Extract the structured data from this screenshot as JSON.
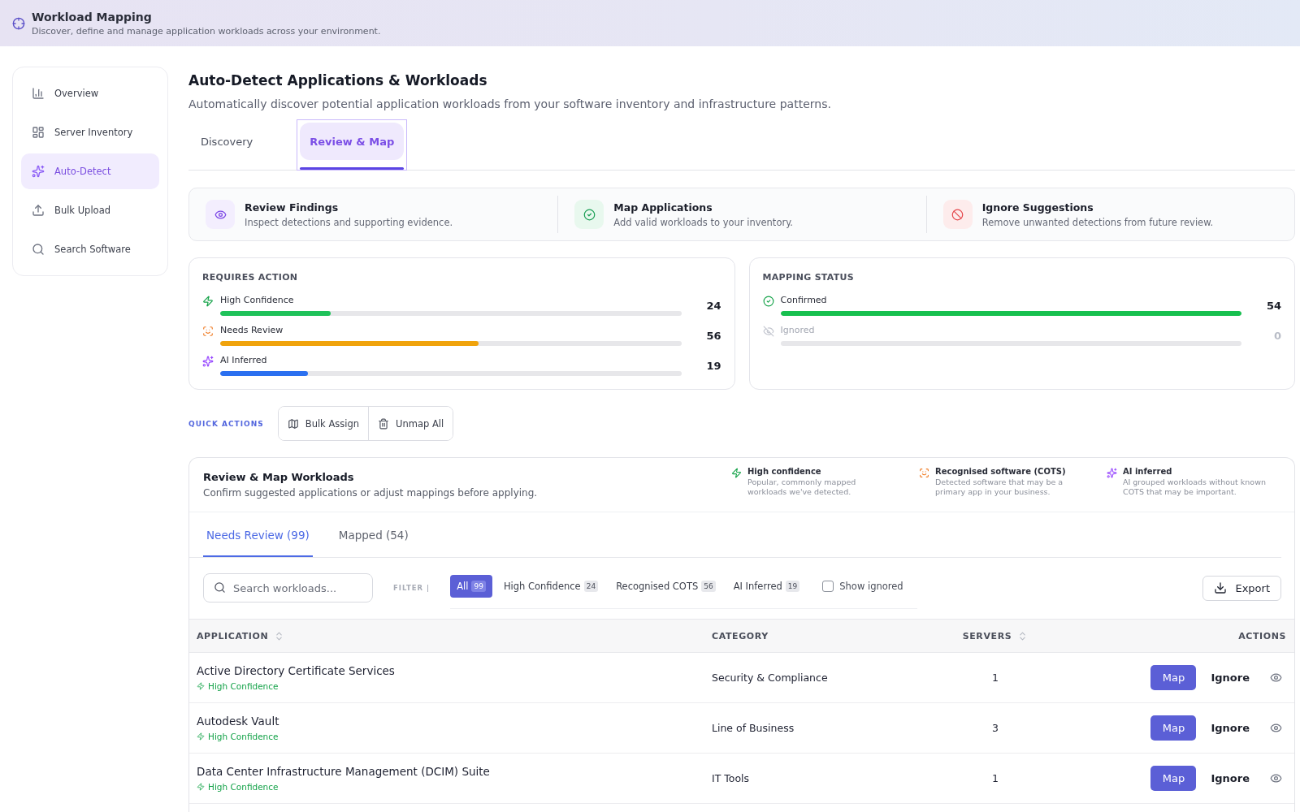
{
  "header": {
    "title": "Workload Mapping",
    "subtitle": "Discover, define and manage application workloads across your environment."
  },
  "sidebar": {
    "items": [
      {
        "label": "Overview",
        "selected": false
      },
      {
        "label": "Server Inventory",
        "selected": false
      },
      {
        "label": "Auto-Detect",
        "selected": true
      },
      {
        "label": "Bulk Upload",
        "selected": false
      },
      {
        "label": "Search Software",
        "selected": false
      }
    ]
  },
  "page": {
    "title": "Auto-Detect Applications & Workloads",
    "subtitle": "Automatically discover potential application workloads from your software inventory and infrastructure patterns."
  },
  "tabs": [
    {
      "label": "Discovery",
      "selected": false,
      "focused": false
    },
    {
      "label": "Review & Map",
      "selected": true,
      "focused": true
    }
  ],
  "steps": [
    {
      "title": "Review Findings",
      "description": "Inspect detections and supporting evidence."
    },
    {
      "title": "Map Applications",
      "description": "Add valid workloads to your inventory."
    },
    {
      "title": "Ignore Suggestions",
      "description": "Remove unwanted detections from future review."
    }
  ],
  "requires_action": {
    "title": "REQUIRES ACTION",
    "rows": [
      {
        "kind": "high",
        "label": "High Confidence",
        "level": 0.24,
        "count": "24",
        "color": "#1fc25a"
      },
      {
        "kind": "cots",
        "label": "Needs Review",
        "level": 0.56,
        "count": "56",
        "color": "#f0a30c"
      },
      {
        "kind": "ai",
        "label": "AI Inferred",
        "level": 0.19,
        "count": "19",
        "color": "#2b70f0"
      }
    ]
  },
  "mapping_status": {
    "title": "MAPPING STATUS",
    "rows": [
      {
        "kind": "confirmed",
        "label": "Confirmed",
        "level": 1,
        "count": "54",
        "color": "#17c04f",
        "disabled": false
      },
      {
        "kind": "ignored",
        "label": "Ignored",
        "count": "0",
        "disabled": true
      }
    ]
  },
  "quick_actions": {
    "label": "QUICK ACTIONS",
    "buttons": [
      "Bulk Assign",
      "Unmap All"
    ]
  },
  "workloads": {
    "title": "Review & Map Workloads",
    "description": "Confirm suggested applications or adjust mappings before applying.",
    "legend": [
      {
        "kind": "high",
        "title": "High confidence",
        "description": "Popular, commonly mapped workloads we've detected."
      },
      {
        "kind": "cots",
        "title": "Recognised software (COTS)",
        "description": "Detected software that may be a primary app in your business."
      },
      {
        "kind": "ai",
        "title": "AI inferred",
        "description": "AI grouped workloads without known COTS that may be important."
      }
    ],
    "tabs": [
      {
        "label": "Needs Review (99)",
        "selected": true
      },
      {
        "label": "Mapped (54)",
        "selected": false
      }
    ],
    "search": {
      "placeholder": "Search workloads..."
    },
    "filter_label": "FILTER |",
    "filters": [
      {
        "label": "All",
        "count": "99",
        "selected": true
      },
      {
        "label": "High Confidence",
        "count": "24",
        "selected": false
      },
      {
        "label": "Recognised COTS",
        "count": "56",
        "selected": false
      },
      {
        "label": "AI Inferred",
        "count": "19",
        "selected": false
      }
    ],
    "show_ignored": {
      "label": "Show ignored",
      "checked": false
    },
    "export": "Export",
    "table": {
      "columns": [
        {
          "label": "APPLICATION",
          "sortable": true
        },
        {
          "label": "CATEGORY",
          "sortable": false
        },
        {
          "label": "SERVERS",
          "sortable": true
        },
        {
          "label": "ACTIONS",
          "sortable": false
        }
      ],
      "rows": [
        {
          "application": "Active Directory Certificate Services",
          "confidence": {
            "kind": "high",
            "label": "High Confidence"
          },
          "category": "Security & Compliance",
          "servers": "1",
          "actions": [
            "Map",
            "Ignore"
          ]
        },
        {
          "application": "Autodesk Vault",
          "confidence": {
            "kind": "high",
            "label": "High Confidence"
          },
          "category": "Line of Business",
          "servers": "3",
          "actions": [
            "Map",
            "Ignore"
          ]
        },
        {
          "application": "Data Center Infrastructure Management (DCIM) Suite",
          "confidence": {
            "kind": "high",
            "label": "High Confidence"
          },
          "category": "IT Tools",
          "servers": "1",
          "actions": [
            "Map",
            "Ignore"
          ]
        }
      ]
    }
  }
}
